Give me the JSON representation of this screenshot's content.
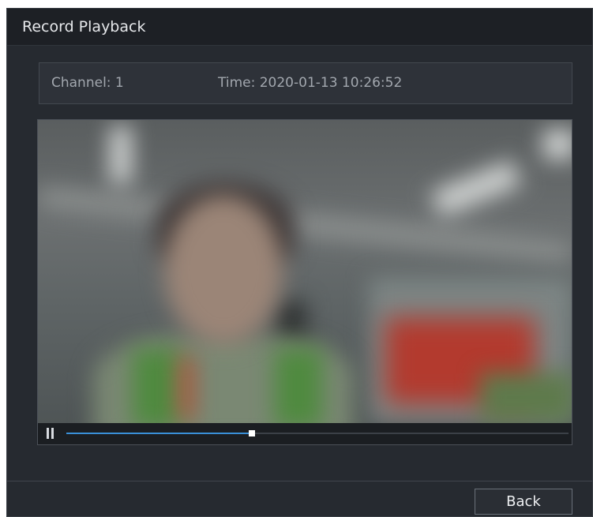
{
  "dialog": {
    "title": "Record Playback"
  },
  "info": {
    "channel": "Channel: 1",
    "time": "Time: 2020-01-13 10:26:52"
  },
  "player": {
    "progress": 0.37,
    "state": "playing",
    "accent_color": "#3a90d8"
  },
  "footer": {
    "back_label": "Back"
  }
}
